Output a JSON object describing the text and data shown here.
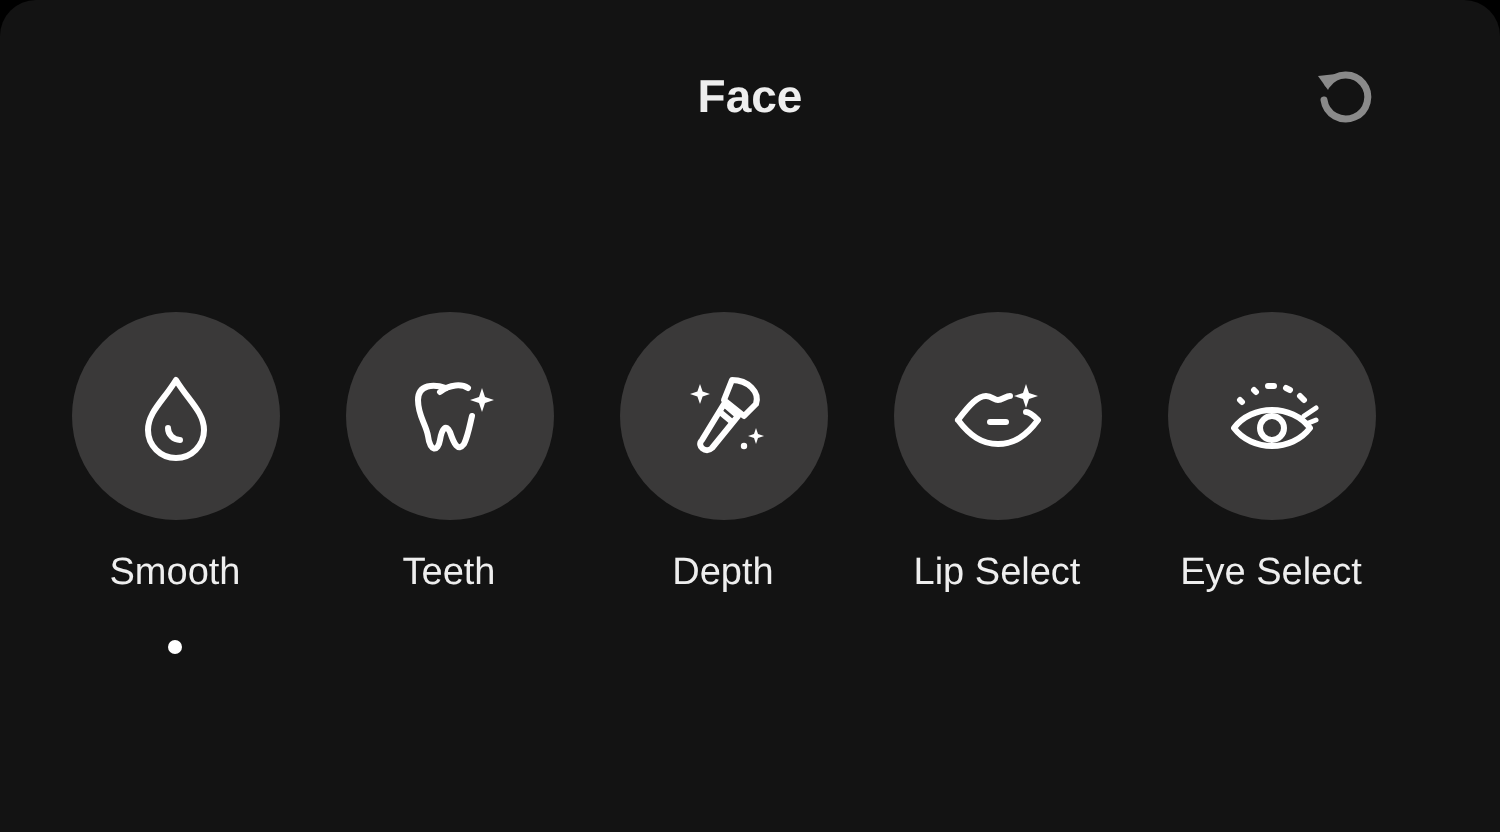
{
  "header": {
    "title": "Face"
  },
  "tools": [
    {
      "label": "Smooth",
      "kind": "drop",
      "selected": true
    },
    {
      "label": "Teeth",
      "kind": "tooth",
      "selected": false
    },
    {
      "label": "Depth",
      "kind": "brush",
      "selected": false
    },
    {
      "label": "Lip Select",
      "kind": "lips",
      "selected": false
    },
    {
      "label": "Eye Select",
      "kind": "eye",
      "selected": false
    }
  ]
}
